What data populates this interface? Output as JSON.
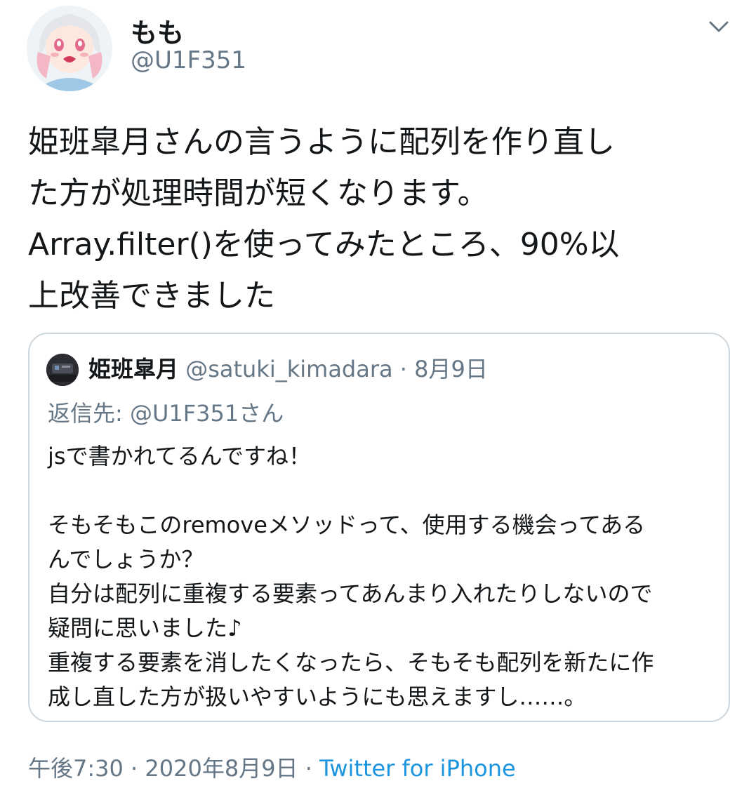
{
  "author": {
    "display_name": "もも",
    "handle": "@U1F351"
  },
  "menu_icon": "chevron-down-icon",
  "tweet": {
    "lines": [
      "姫班皐月さんの言うように配列を作り直し",
      "た方が処理時間が短くなります。",
      "Array.filter()を使ってみたところ、90%以",
      "上改善できました"
    ]
  },
  "quoted_tweet": {
    "display_name": "姫班皐月",
    "handle": "@satuki_kimadara",
    "date": "8月9日",
    "replying_to": "返信先: @U1F351さん",
    "paragraph1": "jsで書かれてるんですね！",
    "paragraph2": [
      "そもそもこのremoveメソッドって、使用する機会ってある",
      "んでしょうか？",
      "自分は配列に重複する要素ってあんまり入れたりしないので",
      "疑問に思いました♪",
      "重複する要素を消したくなったら、そもそも配列を新たに作",
      "成し直した方が扱いやすいようにも思えますし……。"
    ]
  },
  "footer": {
    "time": "午後7:30",
    "date": "2020年8月9日",
    "separator": "·",
    "source": "Twitter for iPhone"
  },
  "colors": {
    "text": "#14171a",
    "secondary": "#657786",
    "link": "#1b95e0",
    "border": "#ccd6dd"
  }
}
